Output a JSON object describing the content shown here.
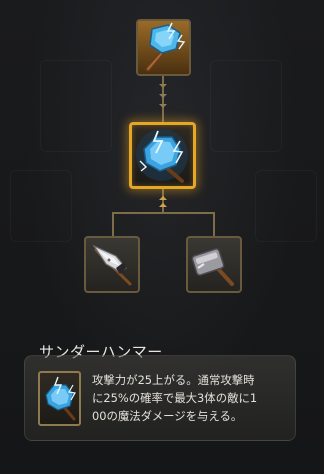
{
  "skill_tree": {
    "nodes": [
      {
        "id": "top",
        "icon": "lightning-hammer-icon",
        "state": "unlocked"
      },
      {
        "id": "middle",
        "icon": "lightning-orb-icon",
        "state": "selected"
      },
      {
        "id": "left-branch",
        "icon": "spear-tip-icon",
        "state": "available"
      },
      {
        "id": "right-branch",
        "icon": "steel-hammer-icon",
        "state": "available"
      }
    ],
    "connector_color": "#7e6d49",
    "highlight_color": "#e6a626"
  },
  "tooltip": {
    "skill_name": "サンダーハンマー",
    "icon": "lightning-orb-icon",
    "description_lines": [
      "攻撃力が25上がる。通常攻撃時",
      "に25%の確率で最大3体の敵に1",
      "00の魔法ダメージを与える。"
    ]
  }
}
